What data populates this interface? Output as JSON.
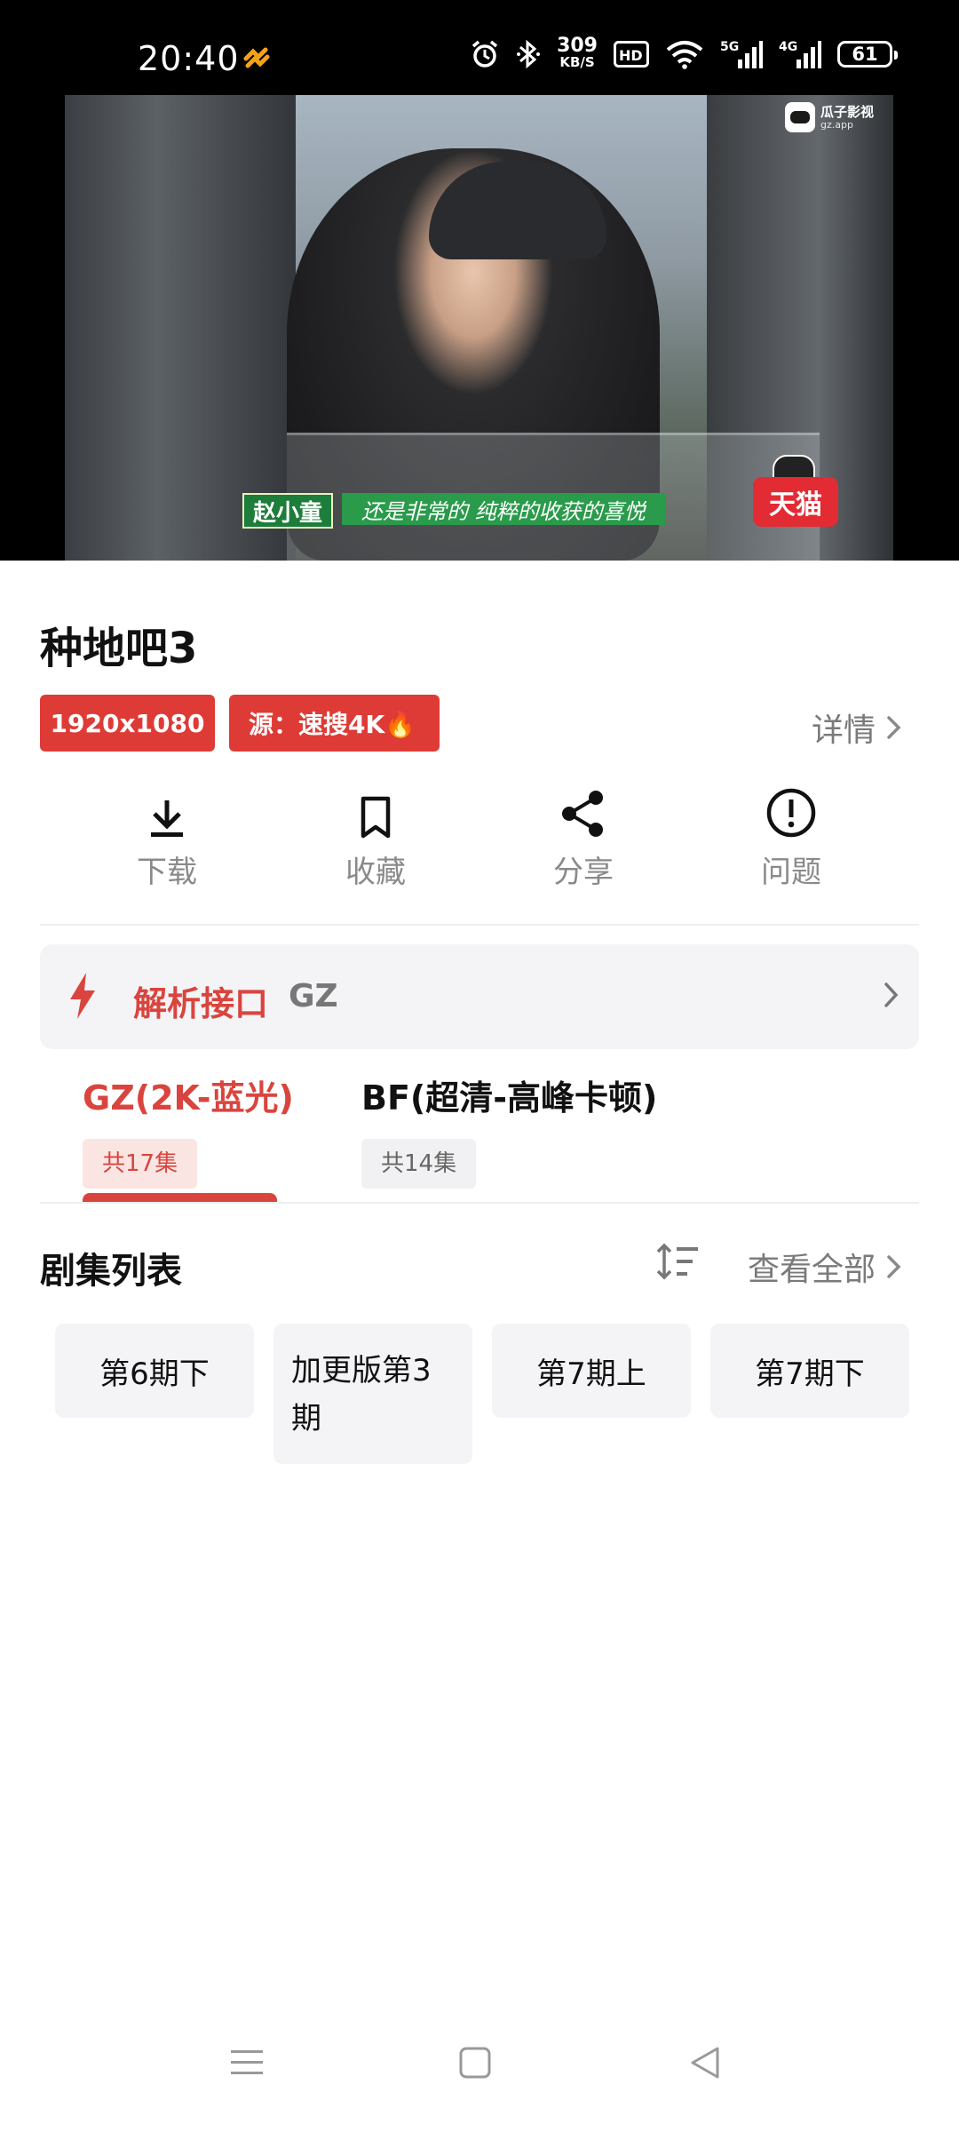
{
  "status_bar": {
    "time": "20:40",
    "net_speed_value": "309",
    "net_speed_unit": "KB/S",
    "network_5g": "5G",
    "network_4g": "4G",
    "battery": "61",
    "icons": [
      "alarm-icon",
      "bluetooth-icon",
      "hd-icon",
      "wifi-icon",
      "signal-5g-icon",
      "signal-4g-icon",
      "battery-icon"
    ]
  },
  "video": {
    "subtitle_name": "赵小童",
    "subtitle_text": "还是非常的 纯粹的收获的喜悦",
    "tmall_badge": "天猫",
    "watermark_title": "瓜子影视",
    "watermark_domain": "gz.app"
  },
  "show": {
    "title": "种地吧3",
    "tags": [
      "1920x1080",
      "源：速搜4K🔥"
    ],
    "details_label": "详情"
  },
  "actions": [
    {
      "label": "下载",
      "icon": "download-icon"
    },
    {
      "label": "收藏",
      "icon": "bookmark-icon"
    },
    {
      "label": "分享",
      "icon": "share-icon"
    },
    {
      "label": "问题",
      "icon": "alert-icon"
    }
  ],
  "parse_interface": {
    "label": "解析接口",
    "value": "GZ"
  },
  "sources": [
    {
      "name": "GZ(2K-蓝光)",
      "count": "共17集",
      "selected": true
    },
    {
      "name": "BF(超清-高峰卡顿)",
      "count": "共14集",
      "selected": false
    }
  ],
  "episodes": {
    "heading": "剧集列表",
    "view_all": "查看全部",
    "items": [
      "第6期下",
      "加更版第3期",
      "第7期上",
      "第7期下"
    ]
  },
  "colors": {
    "accent": "#de3b36",
    "accent_text": "#d9453e",
    "muted_text": "#7a7a7a",
    "card_bg": "#f4f4f7"
  }
}
